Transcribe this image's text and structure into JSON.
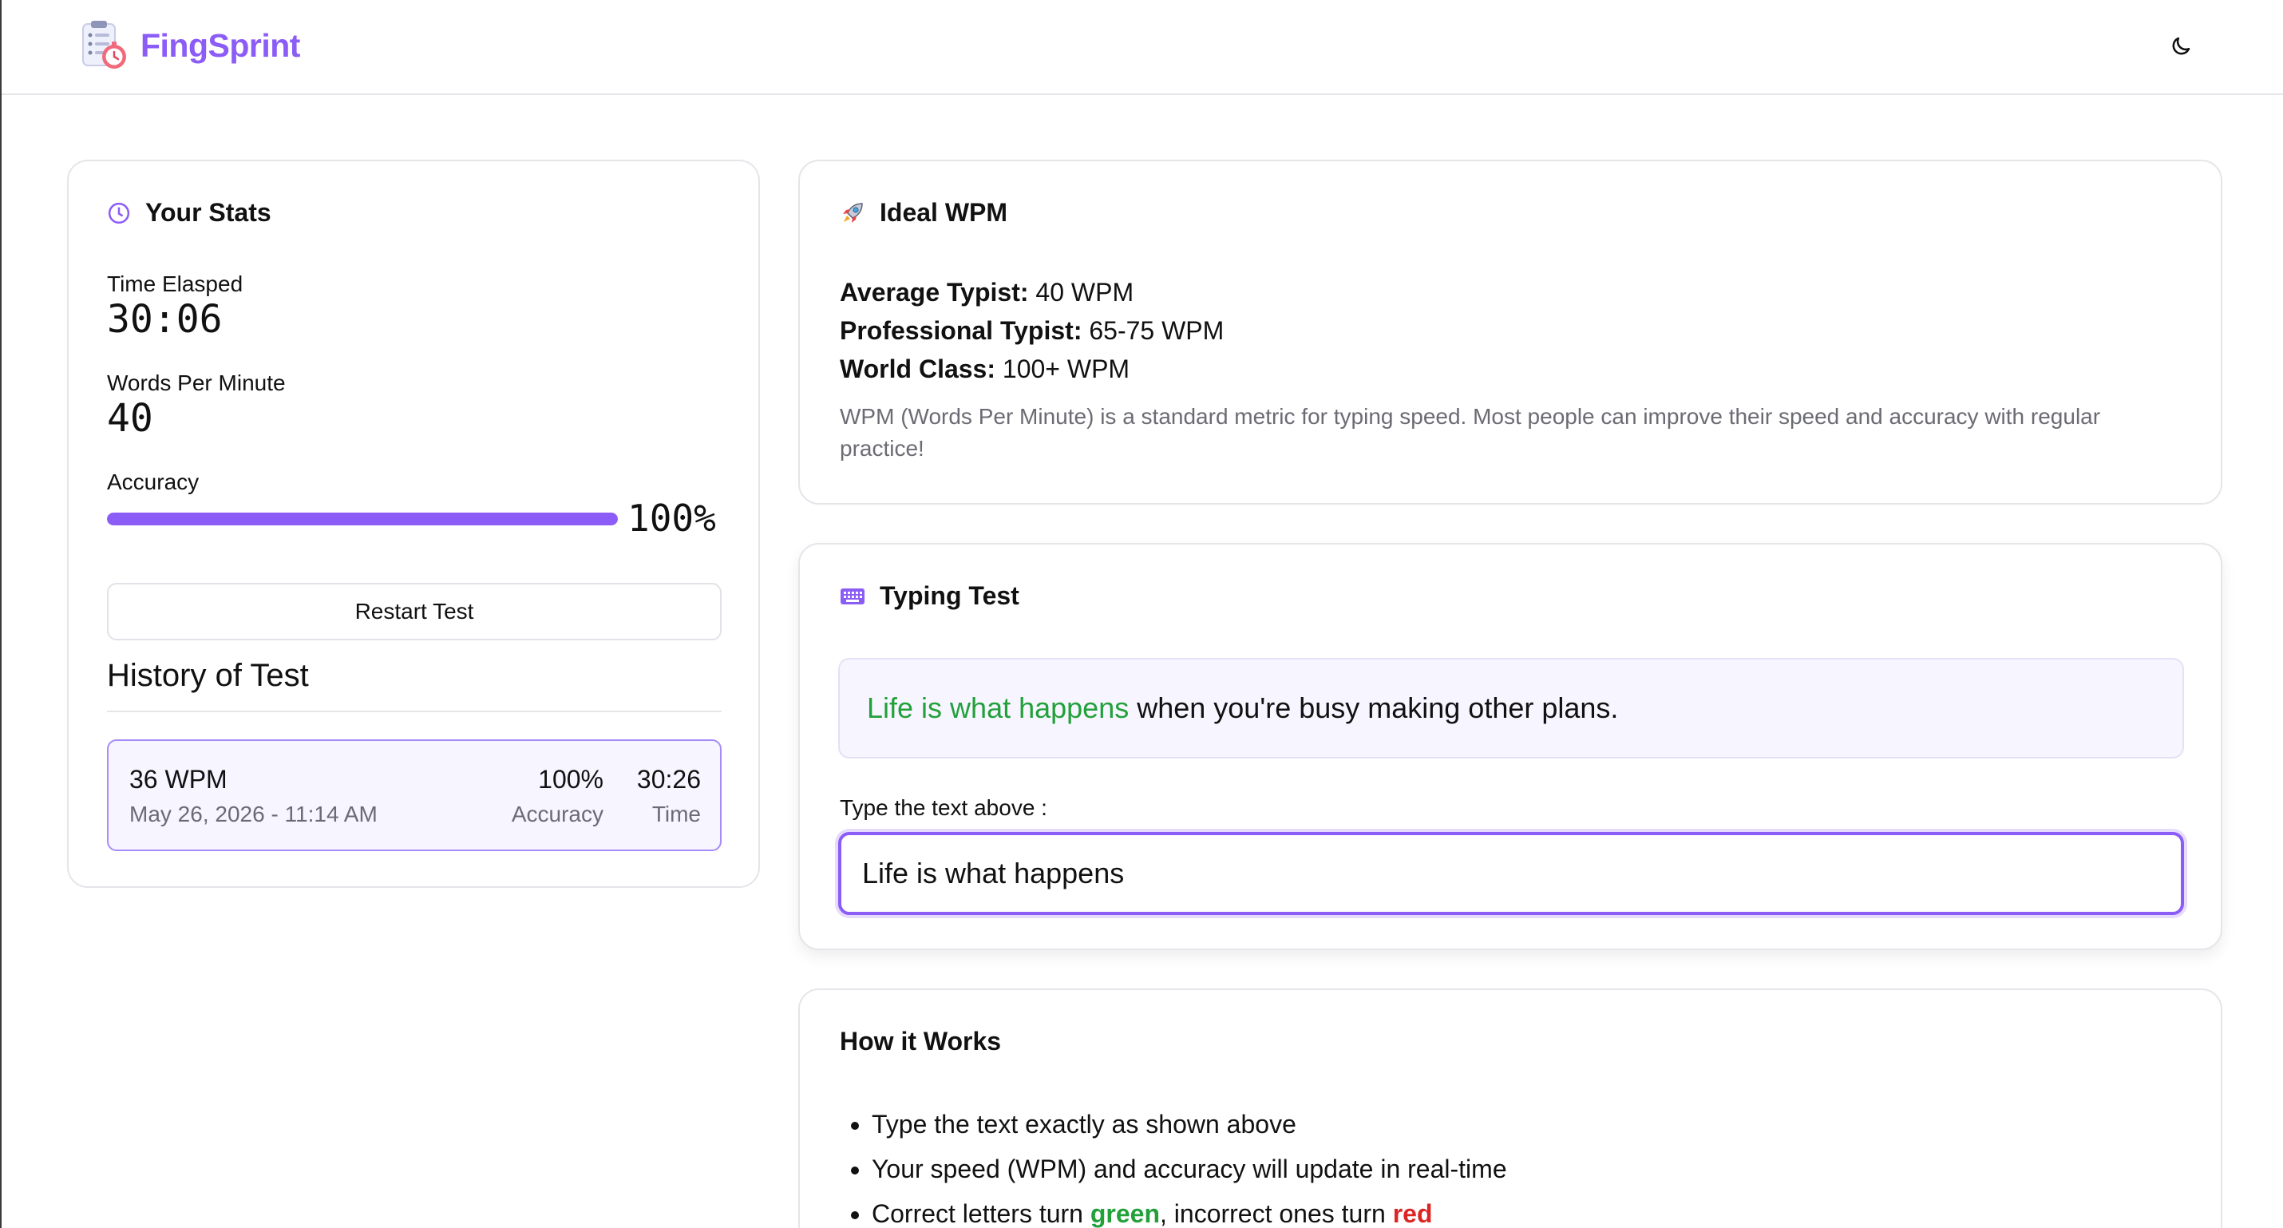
{
  "app": {
    "name": "FingSprint"
  },
  "colors": {
    "accent": "#8b5cf6",
    "correct": "#22a03a",
    "incorrect": "#dc2626"
  },
  "header": {
    "theme_toggle_icon": "moon-icon"
  },
  "stats": {
    "title": "Your Stats",
    "time_elapsed_label": "Time Elasped",
    "time_elapsed_value": "30:06",
    "wpm_label": "Words Per Minute",
    "wpm_value": "40",
    "accuracy_label": "Accuracy",
    "accuracy_value": "100%",
    "accuracy_fraction": 1.0,
    "restart_label": "Restart Test",
    "history_title": "History of Test",
    "history": [
      {
        "wpm": "36 WPM",
        "date": "May 26, 2026 - 11:14 AM",
        "accuracy": "100%",
        "accuracy_label": "Accuracy",
        "time": "30:26",
        "time_label": "Time"
      }
    ]
  },
  "ideal": {
    "title": "Ideal WPM",
    "lines": [
      {
        "label": "Average Typist:",
        "value": "40 WPM"
      },
      {
        "label": "Professional Typist:",
        "value": "65-75 WPM"
      },
      {
        "label": "World Class:",
        "value": "100+ WPM"
      }
    ],
    "description": "WPM (Words Per Minute) is a standard metric for typing speed. Most people can improve their speed and accuracy with regular practice!"
  },
  "typing": {
    "title": "Typing Test",
    "prompt_typed": "Life is what happens",
    "prompt_rest": " when you're busy making other plans.",
    "input_label": "Type the text above :",
    "input_value": "Life is what happens"
  },
  "how": {
    "title": "How it Works",
    "item1": "Type the text exactly as shown above",
    "item2": "Your speed (WPM) and accuracy will update in real-time",
    "item3_prefix": "Correct letters turn ",
    "item3_green": "green",
    "item3_mid": ", incorrect ones turn ",
    "item3_red": "red"
  }
}
